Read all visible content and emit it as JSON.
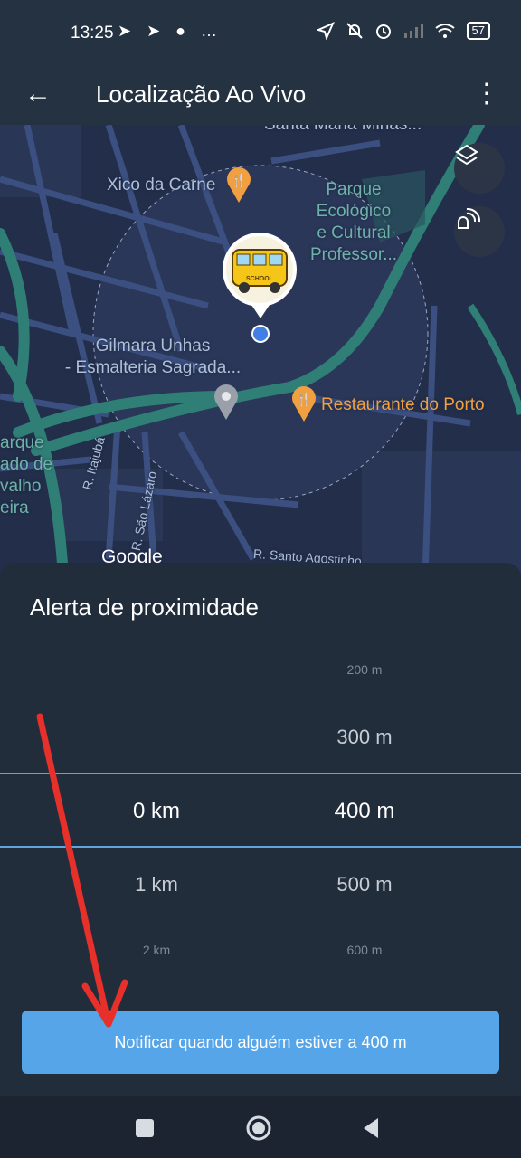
{
  "status_bar": {
    "time": "13:25",
    "left_icons": "➤ ➤ ● …",
    "right_icons": [
      "location-icon",
      "mute-icon",
      "alarm-icon",
      "signal-icon",
      "wifi-icon"
    ],
    "battery": "57"
  },
  "app_bar": {
    "title": "Localização Ao Vivo",
    "back_icon": "←",
    "menu_icon": "⋮"
  },
  "map": {
    "labels": {
      "top": "Santa Maria Minas...",
      "restaurant1": "Xico da Carne",
      "park": "Parque\nEcológico\ne Cultural\nProfessor...",
      "salon": "Gilmara Unhas\n- Esmalteria Sagrada...",
      "restaurant2": "Restaurante do Porto",
      "left": "arque\nado de\nvalho\neira",
      "street1": "R. Itajubá",
      "street2": "R. São Lázaro",
      "street3": "R. Santo Agostinho",
      "google": "Google"
    },
    "bus_badge": "SCHOOL",
    "colors": {
      "bg": "#222e4a",
      "road": "#3a4f7a",
      "highway": "#2f7f76",
      "radius": "#2d3a5e"
    }
  },
  "sheet": {
    "title": "Alerta de proximidade",
    "rows": [
      {
        "km": "",
        "m": "200 m"
      },
      {
        "km": "",
        "m": "300 m"
      },
      {
        "km": "0 km",
        "m": "400 m"
      },
      {
        "km": "1 km",
        "m": "500 m"
      },
      {
        "km": "2 km",
        "m": "600 m"
      }
    ],
    "button": "Notificar quando alguém estiver a 400 m",
    "accent": "#56a5e8"
  },
  "nav": [
    "recents-icon",
    "home-icon",
    "back-icon"
  ]
}
